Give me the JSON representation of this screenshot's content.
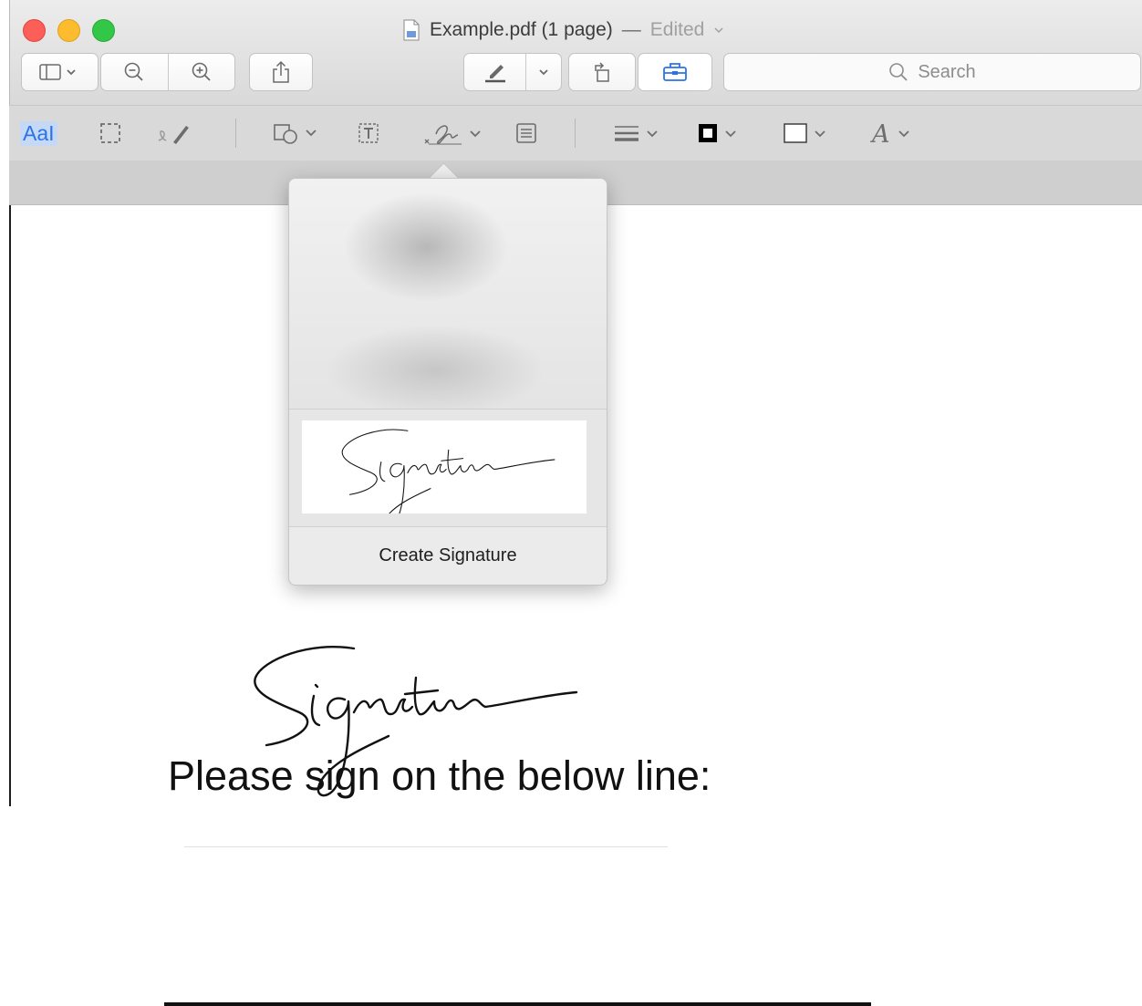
{
  "window": {
    "title": "Example.pdf (1 page)",
    "separator": "—",
    "status": "Edited"
  },
  "toolbar": {
    "search_placeholder": "Search",
    "icons": [
      "sidebar-icon",
      "zoom-out-icon",
      "zoom-in-icon",
      "share-icon",
      "markup-pen-icon",
      "rotate-icon",
      "toolbox-icon"
    ]
  },
  "markup_toolbar": {
    "text_selection_label": "AaI",
    "icons": [
      "rectangular-selection-icon",
      "sketch-icon",
      "shapes-icon",
      "text-box-icon",
      "signature-icon",
      "note-icon",
      "line-style-icon",
      "border-color-icon",
      "fill-color-icon",
      "text-style-icon"
    ]
  },
  "signature_popover": {
    "create_label": "Create Signature",
    "signatures": [
      "Signature"
    ]
  },
  "document": {
    "instruction": "Please sign on the below line:",
    "signature_text": "Signature"
  },
  "colors": {
    "accent": "#2b74e6",
    "close": "#fc5f57",
    "minimize": "#fdbc2e",
    "zoom": "#33c748"
  }
}
